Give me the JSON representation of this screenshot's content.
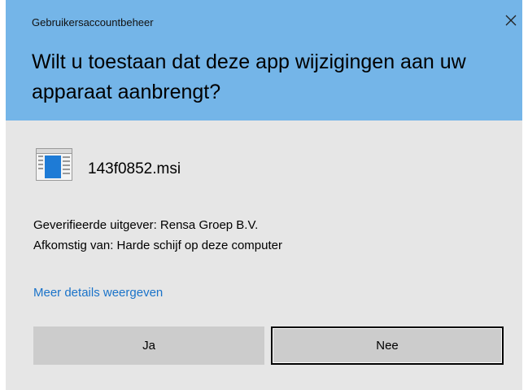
{
  "dialog": {
    "window_title": "Gebruikersaccountbeheer",
    "question": "Wilt u toestaan dat deze app wijzigingen aan uw apparaat aanbrengt?",
    "close_icon": "close-icon"
  },
  "app": {
    "icon": "installer-icon",
    "name": "143f0852.msi"
  },
  "info": {
    "publisher": "Geverifieerde uitgever: Rensa Groep B.V.",
    "origin": "Afkomstig van: Harde schijf op deze computer"
  },
  "details_link": "Meer details weergeven",
  "buttons": {
    "yes_label": "Ja",
    "no_label": "Nee"
  },
  "colors": {
    "header_bg": "#74b5e8",
    "body_bg": "#e6e6e6",
    "button_bg": "#cccccc",
    "link": "#1a73c9"
  }
}
